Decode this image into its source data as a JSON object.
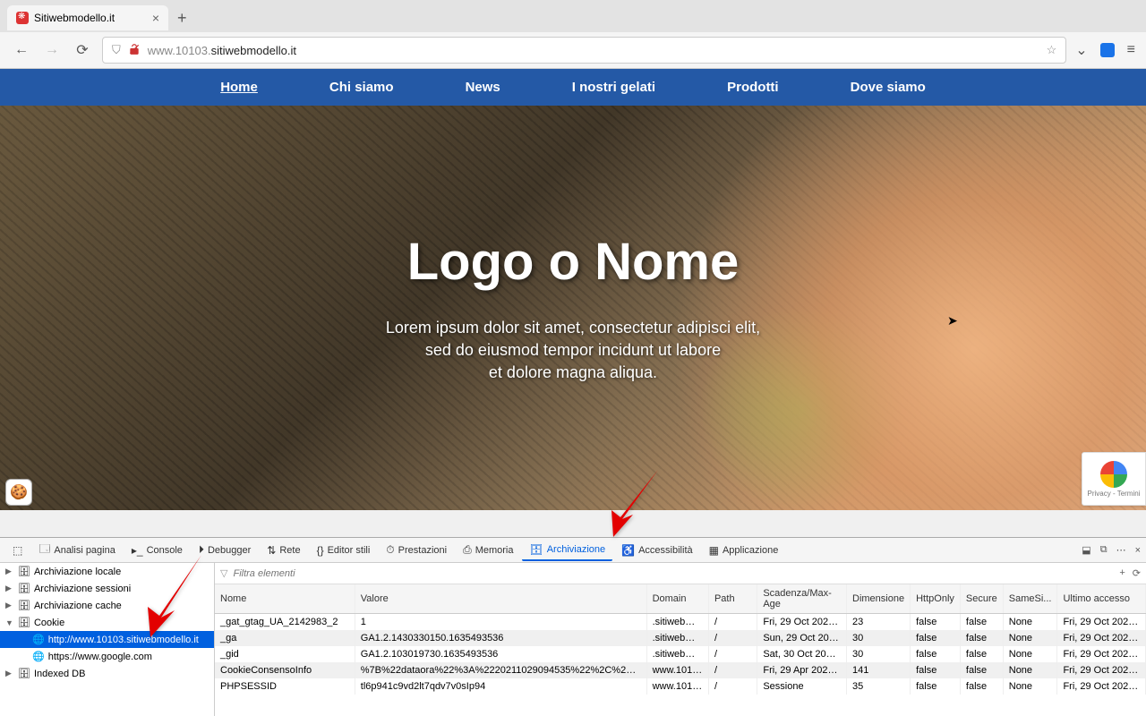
{
  "browser": {
    "tab_title": "Sitiwebmodello.it",
    "url_display": "www.10103.sitiwebmodello.it",
    "url_bold": "sitiwebmodello.it"
  },
  "site_nav": [
    "Home",
    "Chi siamo",
    "News",
    "I nostri gelati",
    "Prodotti",
    "Dove siamo"
  ],
  "hero": {
    "title": "Logo o Nome",
    "line1": "Lorem ipsum dolor sit amet, consectetur adipisci elit,",
    "line2": "sed do eiusmod tempor incidunt ut labore",
    "line3": "et dolore magna aliqua."
  },
  "recaptcha_text": "Privacy - Termini",
  "devtools": {
    "tabs": [
      "Analisi pagina",
      "Console",
      "Debugger",
      "Rete",
      "Editor stili",
      "Prestazioni",
      "Memoria",
      "Archiviazione",
      "Accessibilità",
      "Applicazione"
    ],
    "active_tab": "Archiviazione",
    "filter_placeholder": "Filtra elementi",
    "sidebar": {
      "items": [
        {
          "label": "Archiviazione locale",
          "level": 1,
          "icon": "db",
          "arrow": "▶"
        },
        {
          "label": "Archiviazione sessioni",
          "level": 1,
          "icon": "db",
          "arrow": "▶"
        },
        {
          "label": "Archiviazione cache",
          "level": 1,
          "icon": "db",
          "arrow": "▶"
        },
        {
          "label": "Cookie",
          "level": 1,
          "icon": "db",
          "arrow": "▼"
        },
        {
          "label": "http://www.10103.sitiwebmodello.it",
          "level": 2,
          "icon": "globe",
          "selected": true
        },
        {
          "label": "https://www.google.com",
          "level": 2,
          "icon": "globe"
        },
        {
          "label": "Indexed DB",
          "level": 1,
          "icon": "db",
          "arrow": "▶"
        }
      ]
    },
    "columns": [
      "Nome",
      "Valore",
      "Domain",
      "Path",
      "Scadenza/Max-Age",
      "Dimensione",
      "HttpOnly",
      "Secure",
      "SameSi...",
      "Ultimo accesso"
    ],
    "rows": [
      {
        "nome": "_gat_gtag_UA_2142983_2",
        "valore": "1",
        "domain": ".sitiwebmo...",
        "path": "/",
        "scadenza": "Fri, 29 Oct 2021 0...",
        "dim": "23",
        "http": "false",
        "secure": "false",
        "same": "None",
        "ultimo": "Fri, 29 Oct 2021 0..."
      },
      {
        "nome": "_ga",
        "valore": "GA1.2.1430330150.1635493536",
        "domain": ".sitiwebmo...",
        "path": "/",
        "scadenza": "Sun, 29 Oct 2023 ...",
        "dim": "30",
        "http": "false",
        "secure": "false",
        "same": "None",
        "ultimo": "Fri, 29 Oct 2021 0..."
      },
      {
        "nome": "_gid",
        "valore": "GA1.2.103019730.1635493536",
        "domain": ".sitiwebmo...",
        "path": "/",
        "scadenza": "Sat, 30 Oct 2021 ...",
        "dim": "30",
        "http": "false",
        "secure": "false",
        "same": "None",
        "ultimo": "Fri, 29 Oct 2021 0..."
      },
      {
        "nome": "CookieConsensoInfo",
        "valore": "%7B%22dataora%22%3A%2220211029094535%22%2C%22stamp...",
        "domain": "www.10103...",
        "path": "/",
        "scadenza": "Fri, 29 Apr 2022 0...",
        "dim": "141",
        "http": "false",
        "secure": "false",
        "same": "None",
        "ultimo": "Fri, 29 Oct 2021 0..."
      },
      {
        "nome": "PHPSESSID",
        "valore": "tl6p941c9vd2lt7qdv7v0sIp94",
        "domain": "www.10103...",
        "path": "/",
        "scadenza": "Sessione",
        "dim": "35",
        "http": "false",
        "secure": "false",
        "same": "None",
        "ultimo": "Fri, 29 Oct 2021 0..."
      }
    ]
  }
}
